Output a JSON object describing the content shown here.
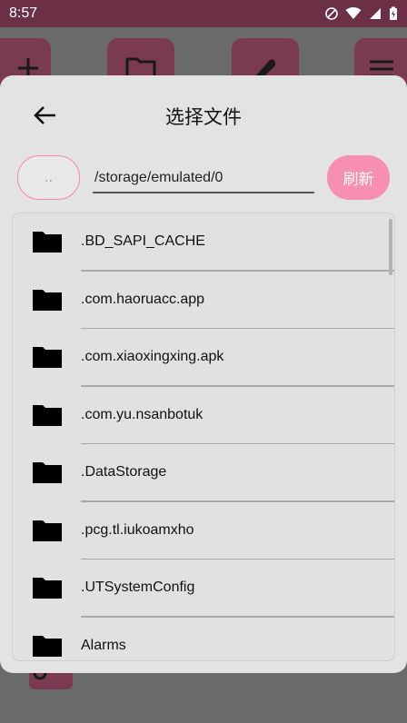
{
  "status_bar": {
    "time": "8:57"
  },
  "dialog": {
    "title": "选择文件",
    "up_label": "..",
    "path_value": "/storage/emulated/0",
    "refresh_label": "刷新"
  },
  "files": [
    {
      "name": ".BD_SAPI_CACHE",
      "icon": "folder-icon"
    },
    {
      "name": ".com.haoruacc.app",
      "icon": "folder-icon"
    },
    {
      "name": ".com.xiaoxingxing.apk",
      "icon": "folder-icon"
    },
    {
      "name": ".com.yu.nsanbotuk",
      "icon": "folder-icon"
    },
    {
      "name": ".DataStorage",
      "icon": "folder-icon"
    },
    {
      "name": ".pcg.tl.iukoamxho",
      "icon": "folder-icon"
    },
    {
      "name": ".UTSystemConfig",
      "icon": "folder-icon"
    },
    {
      "name": "Alarms",
      "icon": "folder-icon"
    }
  ],
  "colors": {
    "status_bar": "#6c3046",
    "accent": "#f78fb0",
    "accent_outline": "#f48aa8",
    "dialog_bg": "#e3e3e3"
  }
}
